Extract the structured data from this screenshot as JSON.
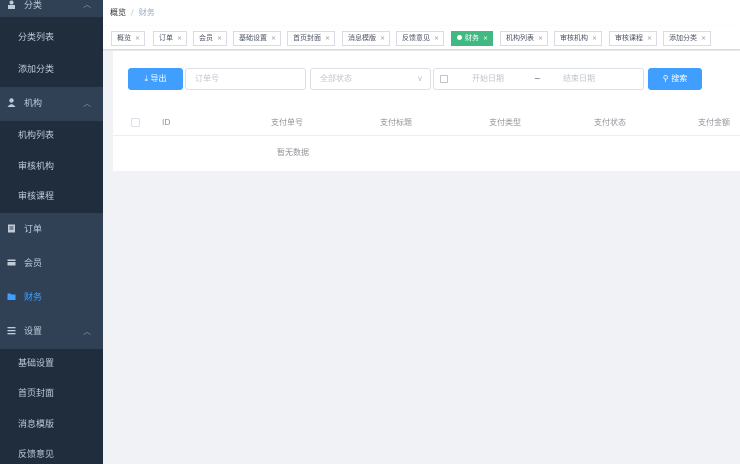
{
  "sidebar": {
    "group1": {
      "label": "分类",
      "items": [
        "分类列表",
        "添加分类"
      ]
    },
    "group2": {
      "label": "机构",
      "items": [
        "机构列表",
        "审核机构",
        "审核课程"
      ]
    },
    "order": "订单",
    "member": "会员",
    "finance": "财务",
    "group3": {
      "label": "设置",
      "items": [
        "基础设置",
        "首页封面",
        "消息模版",
        "反馈意见"
      ]
    }
  },
  "breadcrumb": {
    "home": "概览",
    "separator": "/",
    "current": "财务"
  },
  "tags": [
    "概览",
    "订单",
    "会员",
    "基础设置",
    "首页封面",
    "消息模版",
    "反馈意见",
    "财务",
    "机构列表",
    "审核机构",
    "审核课程",
    "添加分类"
  ],
  "toolbar": {
    "export_label": "导出",
    "order_placeholder": "订单号",
    "status_placeholder": "全部状态",
    "start_date_placeholder": "开始日期",
    "date_separator": "~",
    "end_date_placeholder": "结束日期",
    "search_label": "搜索"
  },
  "table": {
    "columns": [
      "ID",
      "支付单号",
      "支付标题",
      "支付类型",
      "支付状态",
      "支付金额"
    ],
    "empty_text": "暂无数据"
  },
  "colors": {
    "primary": "#409eff",
    "active_tag": "#42b983",
    "sidebar_bg": "#304156",
    "submenu_bg": "#1f2d3d"
  }
}
